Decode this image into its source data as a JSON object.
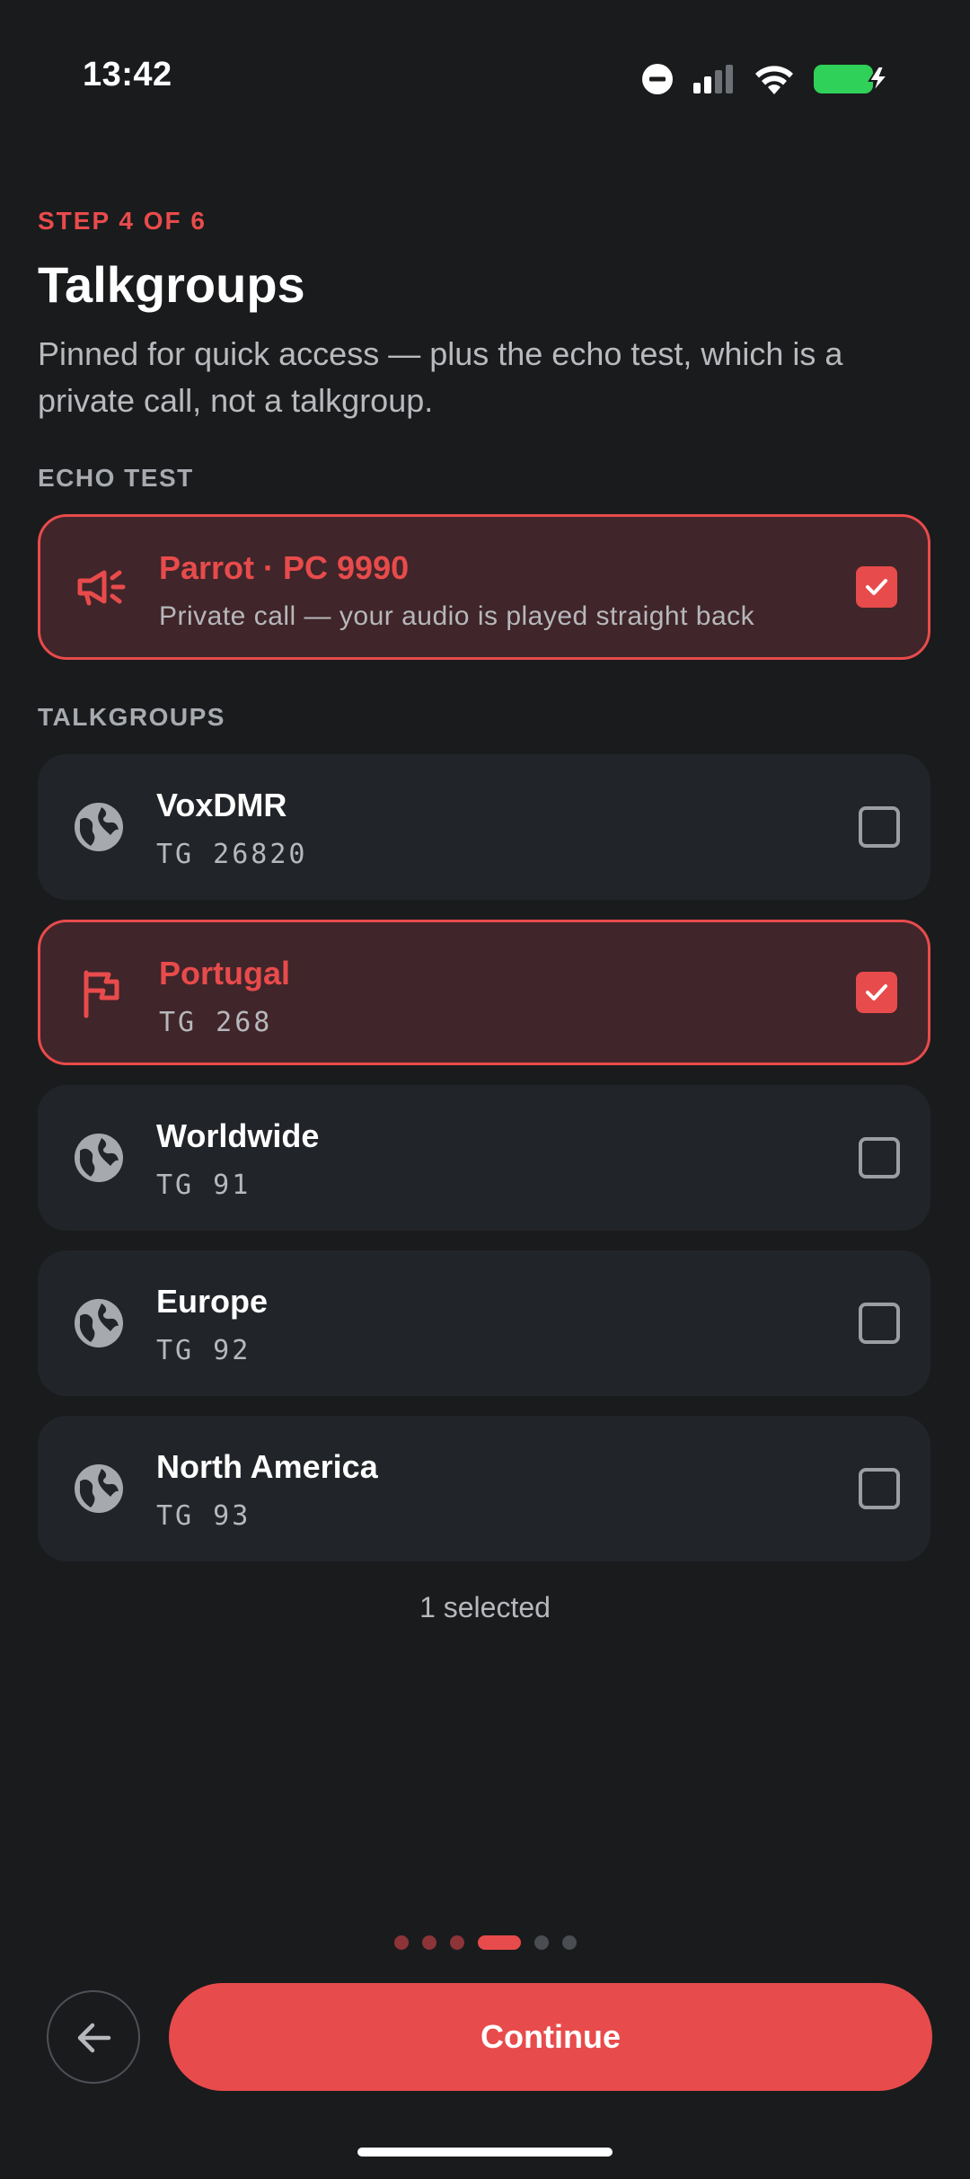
{
  "status_bar": {
    "time": "13:42"
  },
  "header": {
    "step": "STEP 4 OF 6",
    "title": "Talkgroups",
    "subtitle": "Pinned for quick access — plus the echo test, which is a private call, not a talkgroup."
  },
  "echo_section": {
    "label": "ECHO TEST",
    "item": {
      "name": "Parrot · PC 9990",
      "description": "Private call — your audio is played straight back",
      "checked": true,
      "icon": "megaphone-icon"
    }
  },
  "talkgroups_section": {
    "label": "TALKGROUPS",
    "items": [
      {
        "name": "VoxDMR",
        "tg": "TG 26820",
        "checked": false,
        "icon": "globe-icon"
      },
      {
        "name": "Portugal",
        "tg": "TG 268",
        "checked": true,
        "icon": "flag-icon"
      },
      {
        "name": "Worldwide",
        "tg": "TG 91",
        "checked": false,
        "icon": "globe-icon"
      },
      {
        "name": "Europe",
        "tg": "TG 92",
        "checked": false,
        "icon": "globe-icon"
      },
      {
        "name": "North America",
        "tg": "TG 93",
        "checked": false,
        "icon": "globe-icon"
      }
    ]
  },
  "selection_count": "1 selected",
  "pager": {
    "total_steps": 6,
    "current_step": 4
  },
  "footer": {
    "continue_label": "Continue",
    "back_icon": "arrow-left-icon"
  },
  "colors": {
    "accent": "#e84b4b",
    "background": "#1a1b1d",
    "card": "#212428",
    "card_selected": "#40252a"
  }
}
